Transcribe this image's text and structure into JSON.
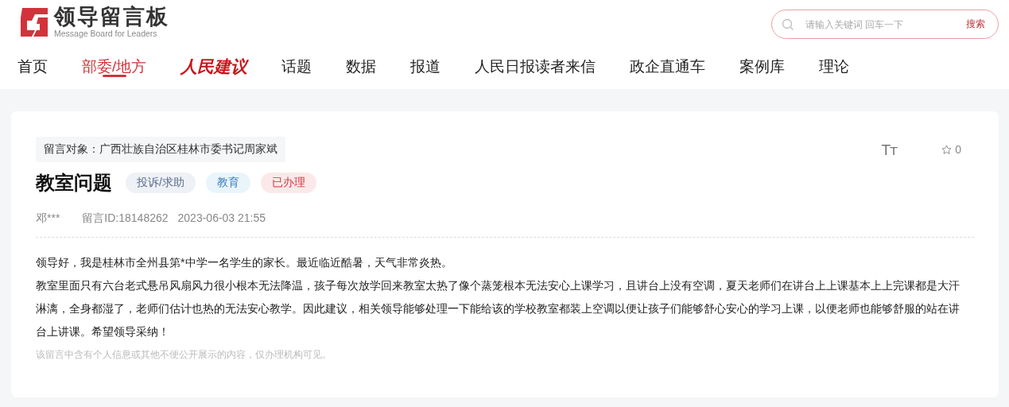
{
  "logo": {
    "title": "领导留言板",
    "subtitle": "Message Board for Leaders"
  },
  "search": {
    "placeholder": "请输入关键词 回车一下",
    "button": "搜索"
  },
  "nav": [
    {
      "label": "首页",
      "kind": "text",
      "selected": false
    },
    {
      "label": "部委/地方",
      "kind": "text",
      "selected": true
    },
    {
      "label": "人民建议",
      "kind": "brand",
      "selected": false
    },
    {
      "label": "话题",
      "kind": "text",
      "selected": false
    },
    {
      "label": "数据",
      "kind": "text",
      "selected": false
    },
    {
      "label": "报道",
      "kind": "text",
      "selected": false
    },
    {
      "label": "人民日报读者来信",
      "kind": "text",
      "selected": false
    },
    {
      "label": "政企直通车",
      "kind": "text",
      "selected": false
    },
    {
      "label": "案例库",
      "kind": "text",
      "selected": false
    },
    {
      "label": "理论",
      "kind": "text",
      "selected": false
    }
  ],
  "message": {
    "recipient": "留言对象：广西壮族自治区桂林市委书记周家斌",
    "font_toggle": "Tт",
    "favorites": "0",
    "title": "教室问题",
    "tags": [
      {
        "label": "投诉/求助",
        "kind": "type"
      },
      {
        "label": "教育",
        "kind": "topic"
      },
      {
        "label": "已办理",
        "kind": "status"
      }
    ],
    "author": "邓***",
    "id": "留言ID:18148262",
    "time": "2023-06-03 21:55",
    "paragraphs": [
      "领导好，我是桂林市全州县第*中学一名学生的家长。最近临近酷暑，天气非常炎热。",
      "教室里面只有六台老式悬吊风扇风力很小根本无法降温，孩子每次放学回来教室太热了像个蒸笼根本无法安心上课学习，且讲台上没有空调，夏天老师们在讲台上上课基本上上完课都是大汗淋漓，全身都湿了，老师们估计也热的无法安心教学。因此建议，相关领导能够处理一下能给该的学校教室都装上空调以便让孩子们能够舒心安心的学习上课，以便老师也能够舒服的站在讲台上讲课。希望领导采纳！"
    ],
    "note": "该留言中含有个人信息或其他不便公开展示的内容，仅办理机构可见。"
  }
}
